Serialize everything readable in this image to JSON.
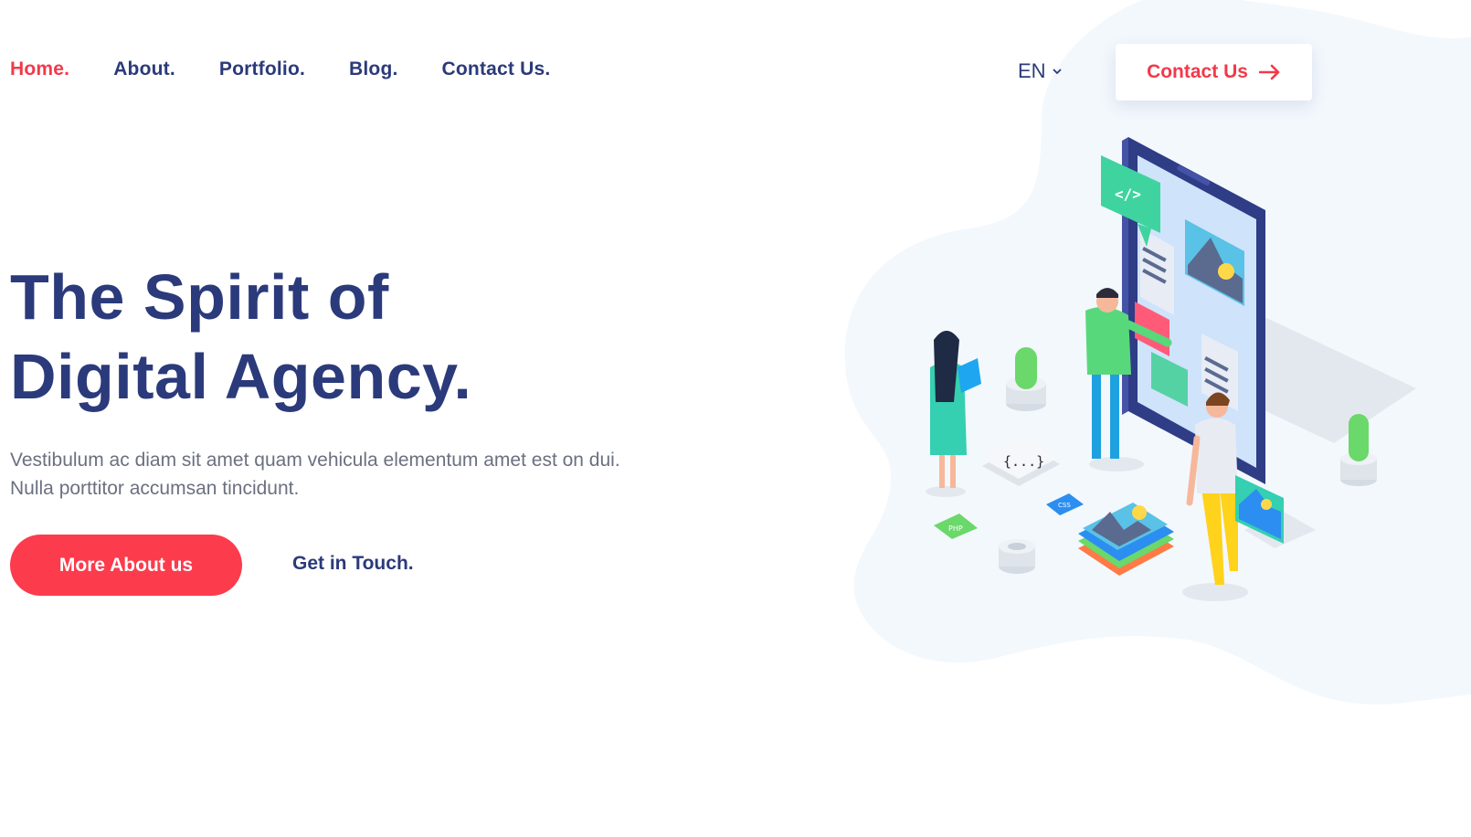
{
  "nav": {
    "items": [
      {
        "label": "Home.",
        "active": true
      },
      {
        "label": "About.",
        "active": false
      },
      {
        "label": "Portfolio.",
        "active": false
      },
      {
        "label": "Blog.",
        "active": false
      },
      {
        "label": "Contact Us.",
        "active": false
      }
    ]
  },
  "language": {
    "selected": "EN",
    "icon": "chevron-down-icon"
  },
  "header_cta": {
    "label": "Contact Us",
    "icon": "arrow-right-icon"
  },
  "hero": {
    "title_line1": "The Spirit of",
    "title_line2": "Digital Agency.",
    "description": "Vestibulum ac diam sit amet quam vehicula elementum amet est on dui. Nulla porttitor accumsan tincidunt.",
    "primary_button": "More About us",
    "secondary_link": "Get in Touch."
  },
  "illustration": {
    "code_tag": "</>",
    "braces": "{...}",
    "badge_php": "PHP",
    "badge_css": "CSS"
  },
  "colors": {
    "brand_red": "#fc3b4c",
    "navy": "#2b3a7a",
    "text_gray": "#6b7080",
    "blob": "#f3f8fd"
  }
}
